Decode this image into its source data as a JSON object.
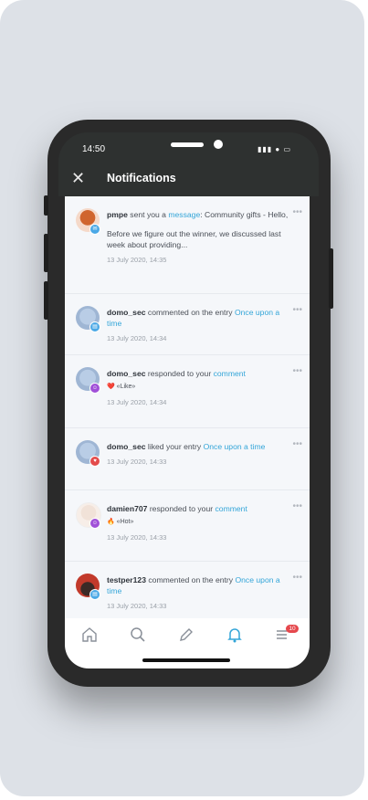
{
  "status_bar": {
    "time": "14:50",
    "icons": "▮▮▮ ● ▭"
  },
  "header": {
    "title": "Notifications",
    "close_glyph": "✕"
  },
  "notifications": [
    {
      "user": "pmpe",
      "action": " sent you a ",
      "link": "message",
      "suffix": ": Community gifts - Hello,",
      "body": "Before we figure out the winner, we discussed last week about providing...",
      "timestamp": "13 July 2020, 14:35",
      "badge_color": "#4aa8e6"
    },
    {
      "user": "domo_sec",
      "action": " commented on the entry ",
      "link": "Once upon a time",
      "timestamp": "13 July 2020, 14:34",
      "badge_color": "#4aa8e6"
    },
    {
      "user": "domo_sec",
      "action": " responded to your ",
      "link": "comment",
      "reaction": "❤️",
      "reaction_label": "«Like»",
      "timestamp": "13 July 2020, 14:34",
      "badge_color": "#a050d8"
    },
    {
      "user": "domo_sec",
      "action": " liked your entry ",
      "link": "Once upon a time",
      "timestamp": "13 July 2020, 14:33",
      "badge_color": "#e34b4b"
    },
    {
      "user": "damien707",
      "action": " responded to your ",
      "link": "comment",
      "reaction": "🔥",
      "reaction_label": "«Hot»",
      "timestamp": "13 July 2020, 14:33",
      "badge_color": "#a050d8"
    },
    {
      "user": "testper123",
      "action": " commented on the entry ",
      "link": "Once upon a time",
      "timestamp": "13 July 2020, 14:33",
      "badge_color": "#4aa8e6"
    }
  ],
  "more_glyph": "•••",
  "tabbar": {
    "items": [
      "home-icon",
      "search-icon",
      "pencil-icon",
      "bell-icon",
      "menu-icon"
    ],
    "active": "bell-icon",
    "active_color": "#33a5d8",
    "menu_badge": "10"
  }
}
